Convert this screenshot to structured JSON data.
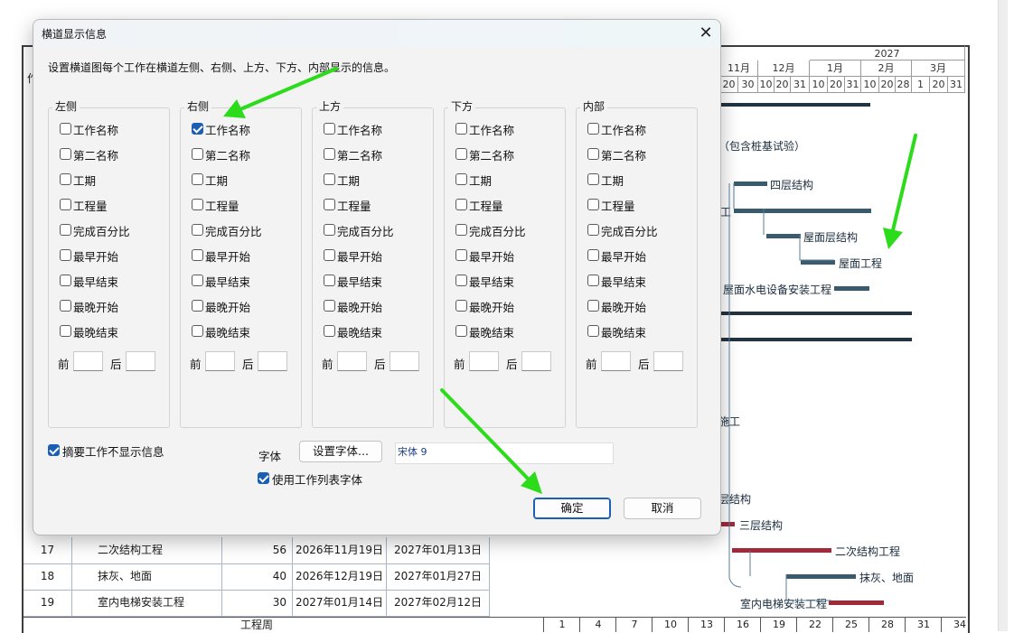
{
  "dialog": {
    "title": "横道显示信息",
    "close_glyph": "✕",
    "intro": "设置横道图每个工作在横道左侧、右侧、上方、下方、内部显示的信息。",
    "item_labels": [
      "工作名称",
      "第二名称",
      "工期",
      "工程量",
      "完成百分比",
      "最早开始",
      "最早结束",
      "最晚开始",
      "最晚结束"
    ],
    "groups": [
      {
        "title": "左侧",
        "checked": [
          false,
          false,
          false,
          false,
          false,
          false,
          false,
          false,
          false
        ]
      },
      {
        "title": "右侧",
        "checked": [
          true,
          false,
          false,
          false,
          false,
          false,
          false,
          false,
          false
        ]
      },
      {
        "title": "上方",
        "checked": [
          false,
          false,
          false,
          false,
          false,
          false,
          false,
          false,
          false
        ]
      },
      {
        "title": "下方",
        "checked": [
          false,
          false,
          false,
          false,
          false,
          false,
          false,
          false,
          false
        ]
      },
      {
        "title": "内部",
        "checked": [
          false,
          false,
          false,
          false,
          false,
          false,
          false,
          false,
          false
        ]
      }
    ],
    "before_label": "前",
    "after_label": "后",
    "summary_checkbox": {
      "label": "摘要工作不显示信息",
      "checked": true
    },
    "font_label": "字体",
    "set_font_button": "设置字体...",
    "font_value": "宋体 9",
    "use_list_font": {
      "label": "使用工作列表字体",
      "checked": true
    },
    "ok_button": "确定",
    "cancel_button": "取消"
  },
  "gantt": {
    "year_label": "2027",
    "months": [
      "11月",
      "12月",
      "1月",
      "2月",
      "3月"
    ],
    "days": [
      "20",
      "30",
      "10",
      "20",
      "31",
      "10",
      "20",
      "31",
      "10",
      "20",
      "28",
      "1",
      "20",
      "31"
    ],
    "visible_col_fragment": "作",
    "labels": {
      "pile": "（包含桩基试验）",
      "floor4": "四层结构",
      "gong": "工",
      "roof_struct": "屋面层结构",
      "roof_work": "屋面工程",
      "roof_mep": "屋面水电设备安装工程",
      "shigong": "施工",
      "ceng": "层结构",
      "floor3": "三层结构",
      "secondary": "二次结构工程",
      "plaster": "抹灰、地面",
      "elevator": "室内电梯安装工程"
    },
    "rows": [
      {
        "no": "17",
        "name": "二次结构工程",
        "dur": "56",
        "start": "2026年11月19日",
        "end": "2027年01月13日"
      },
      {
        "no": "18",
        "name": "抹灰、地面",
        "dur": "40",
        "start": "2026年12月19日",
        "end": "2027年01月27日"
      },
      {
        "no": "19",
        "name": "室内电梯安装工程",
        "dur": "30",
        "start": "2027年01月14日",
        "end": "2027年02月12日"
      }
    ],
    "footer_label": "工程周",
    "weeks": [
      "1",
      "4",
      "7",
      "10",
      "13",
      "16",
      "19",
      "22",
      "25",
      "28",
      "31",
      "34"
    ]
  }
}
